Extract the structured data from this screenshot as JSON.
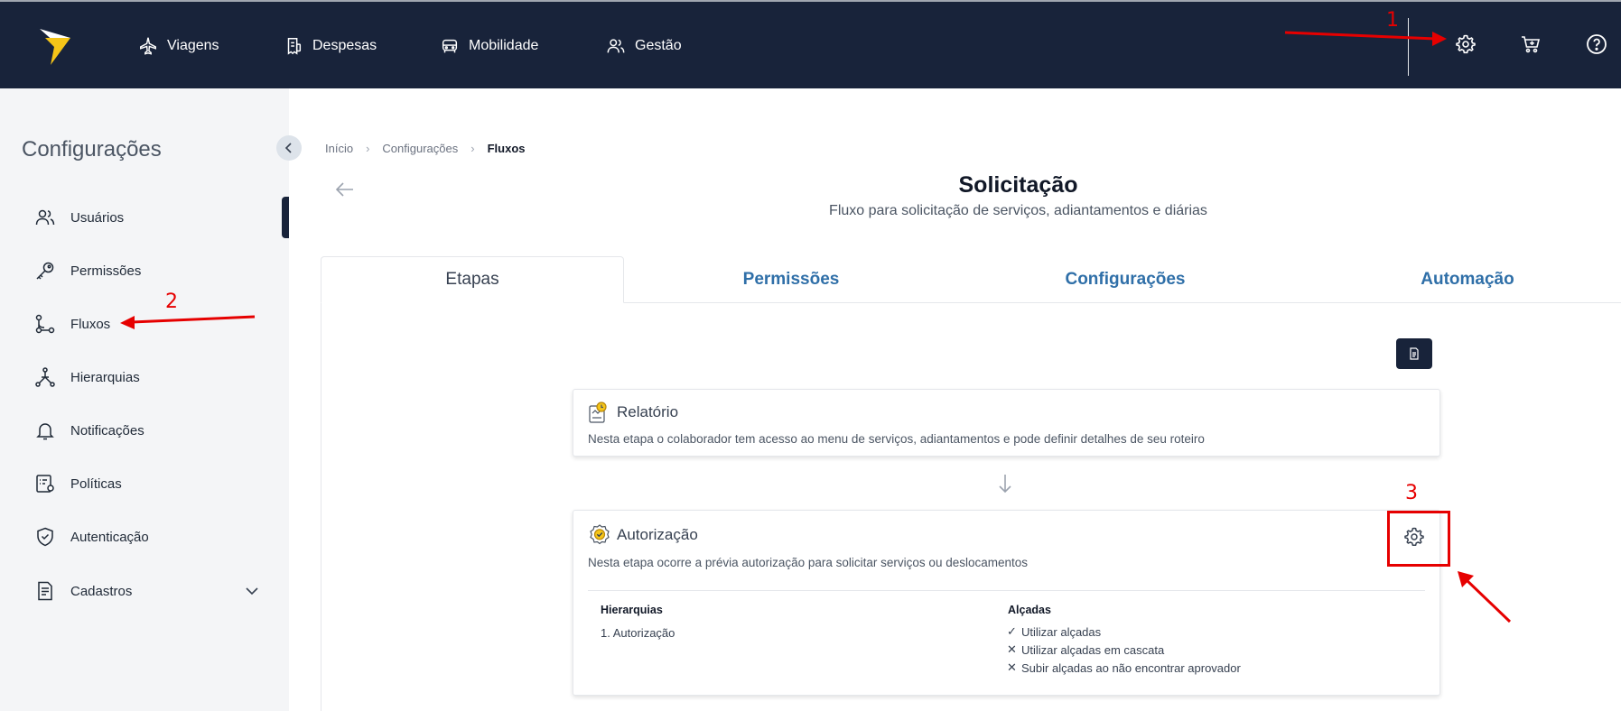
{
  "topnav": {
    "items": [
      {
        "label": "Viagens",
        "icon": "airplane-icon"
      },
      {
        "label": "Despesas",
        "icon": "receipt-icon"
      },
      {
        "label": "Mobilidade",
        "icon": "car-icon"
      },
      {
        "label": "Gestão",
        "icon": "users-icon"
      }
    ],
    "right_icons": [
      "gear-icon",
      "cart-icon",
      "help-icon"
    ]
  },
  "sidebar": {
    "title": "Configurações",
    "items": [
      {
        "label": "Usuários",
        "icon": "users-icon"
      },
      {
        "label": "Permissões",
        "icon": "key-icon"
      },
      {
        "label": "Fluxos",
        "icon": "flow-icon"
      },
      {
        "label": "Hierarquias",
        "icon": "hierarchy-icon"
      },
      {
        "label": "Notificações",
        "icon": "bell-icon"
      },
      {
        "label": "Políticas",
        "icon": "policy-icon"
      },
      {
        "label": "Autenticação",
        "icon": "shield-icon"
      },
      {
        "label": "Cadastros",
        "icon": "document-icon"
      }
    ]
  },
  "breadcrumb": [
    "Início",
    "Configurações",
    "Fluxos"
  ],
  "page": {
    "title": "Solicitação",
    "subtitle": "Fluxo para solicitação de serviços, adiantamentos e diárias"
  },
  "tabs": [
    "Etapas",
    "Permissões",
    "Configurações",
    "Automação"
  ],
  "cards": [
    {
      "title": "Relatório",
      "description": "Nesta etapa o colaborador tem acesso ao menu de serviços, adiantamentos e pode definir detalhes de seu roteiro"
    },
    {
      "title": "Autorização",
      "description": "Nesta etapa ocorre a prévia autorização para solicitar serviços ou deslocamentos",
      "hierarquias_label": "Hierarquias",
      "hierarquias_value": "1. Autorização",
      "alcadas_label": "Alçadas",
      "alcadas": [
        {
          "mark": "✓",
          "text": "Utilizar alçadas"
        },
        {
          "mark": "✕",
          "text": "Utilizar alçadas em cascata"
        },
        {
          "mark": "✕",
          "text": "Subir alçadas ao não encontrar aprovador"
        }
      ]
    }
  ],
  "annotations": [
    "1",
    "2",
    "3"
  ],
  "colors": {
    "navbar": "#18233a",
    "tab_link": "#2f6fa8",
    "logo": "#f5c518",
    "annotation": "#e60000"
  }
}
